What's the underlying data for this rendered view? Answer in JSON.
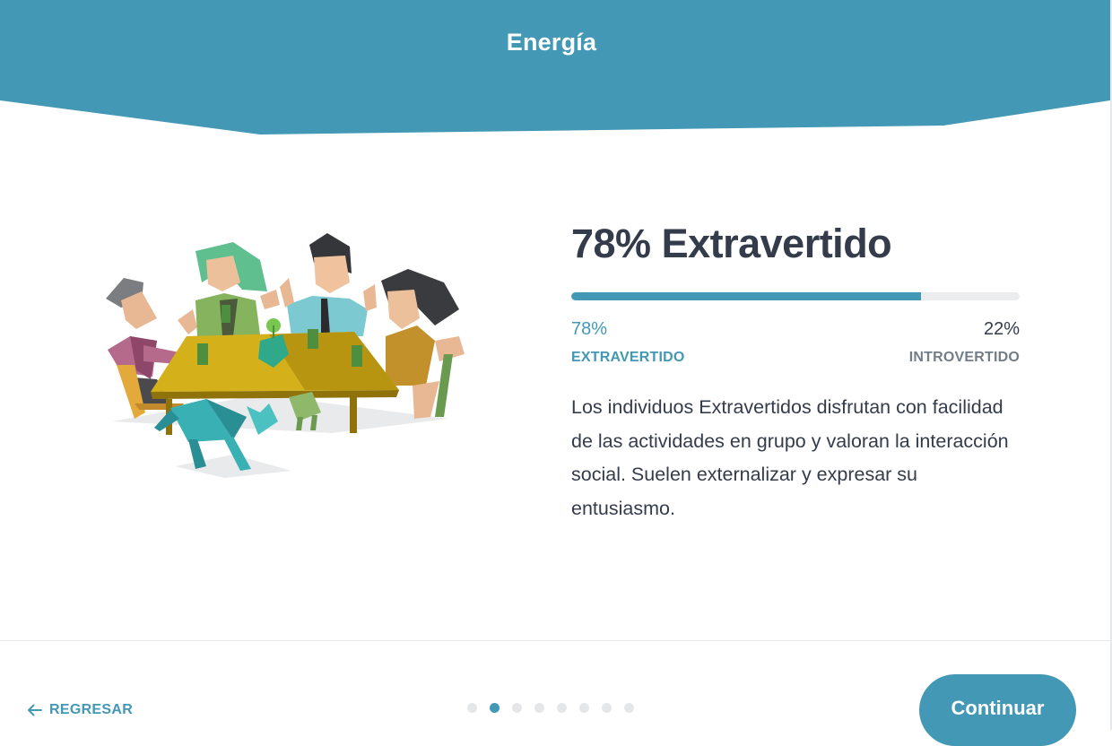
{
  "header": {
    "title": "Energía"
  },
  "colors": {
    "accent": "#4298b5",
    "text": "#343c4b",
    "muted": "#737d87",
    "track": "#eaecee"
  },
  "result": {
    "heading": "78% Extravertido",
    "progress": 0.78,
    "left_percent": "78%",
    "left_label": "EXTRAVERTIDO",
    "right_percent": "22%",
    "right_label": "INTROVERTIDO",
    "description": "Los individuos Extravertidos disfrutan con facilidad de las actividades en grupo y valoran la interacción social. Suelen externalizar y expresar su entusiasmo."
  },
  "illustration": {
    "icon": "people-at-table-illustration"
  },
  "footer": {
    "back_label": "REGRESAR",
    "back_icon": "arrow-left-icon",
    "continue_label": "Continuar",
    "page_dots": {
      "count": 8,
      "active_index": 1
    }
  }
}
